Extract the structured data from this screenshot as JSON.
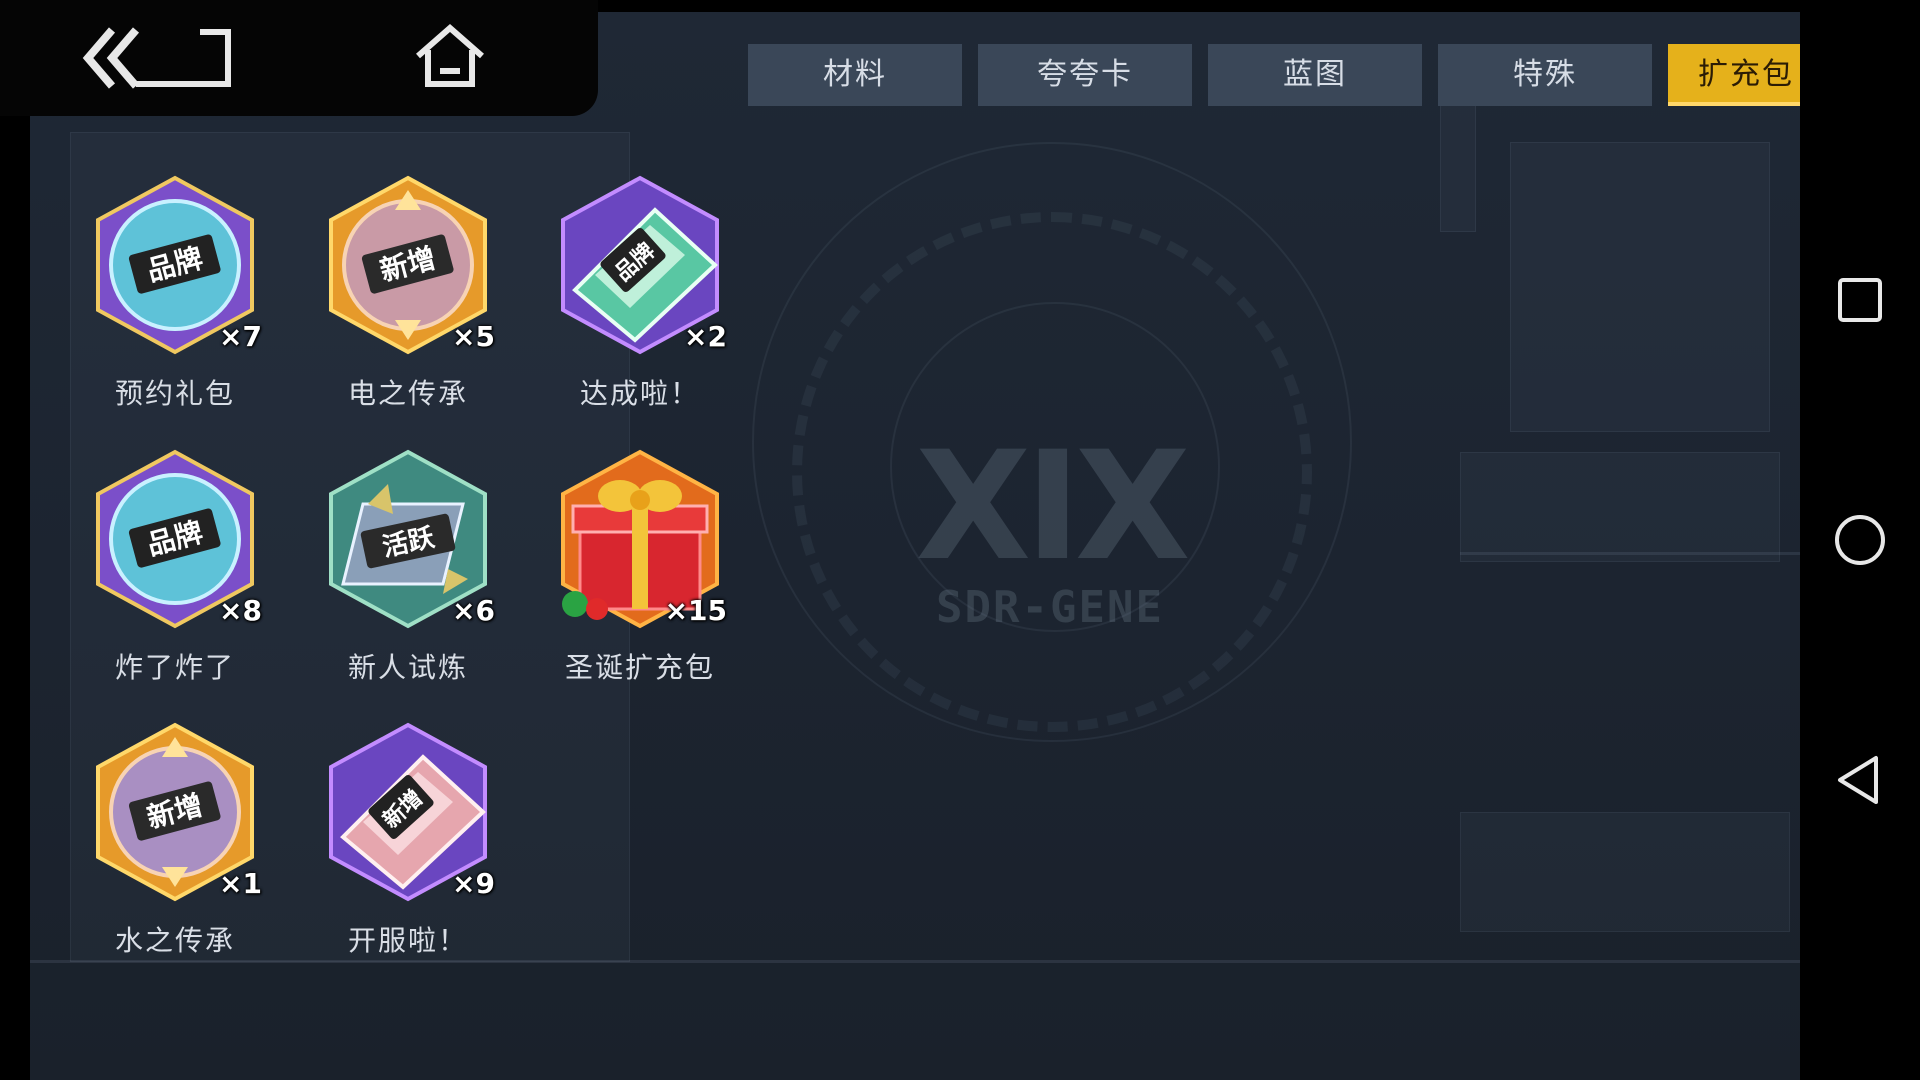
{
  "tabs": [
    {
      "label": "材料",
      "active": false
    },
    {
      "label": "夸夸卡",
      "active": false
    },
    {
      "label": "蓝图",
      "active": false
    },
    {
      "label": "特殊",
      "active": false
    },
    {
      "label": "扩充包",
      "active": true
    }
  ],
  "logo": {
    "mark": "XIX",
    "text": "SDR-GENE"
  },
  "items": [
    {
      "name": "预约礼包",
      "qty": "×7",
      "icon": "brand-badge-icon",
      "badge_text": "品牌"
    },
    {
      "name": "电之传承",
      "qty": "×5",
      "icon": "new-badge-icon",
      "badge_text": "新增"
    },
    {
      "name": "达成啦！",
      "qty": "×2",
      "icon": "brand-card-icon",
      "badge_text": "品牌"
    },
    {
      "name": "炸了炸了",
      "qty": "×8",
      "icon": "brand-badge-icon",
      "badge_text": "品牌"
    },
    {
      "name": "新人试炼",
      "qty": "×6",
      "icon": "active-badge-icon",
      "badge_text": "活跃"
    },
    {
      "name": "圣诞扩充包",
      "qty": "×15",
      "icon": "christmas-gift-icon",
      "badge_text": ""
    },
    {
      "name": "水之传承",
      "qty": "×1",
      "icon": "new-badge-icon",
      "badge_text": "新增"
    },
    {
      "name": "开服啦！",
      "qty": "×9",
      "icon": "new-card-icon",
      "badge_text": "新增"
    }
  ],
  "colors": {
    "accent": "#e5b11b",
    "tab_bg": "#3a4758",
    "background": "#1f2835"
  }
}
